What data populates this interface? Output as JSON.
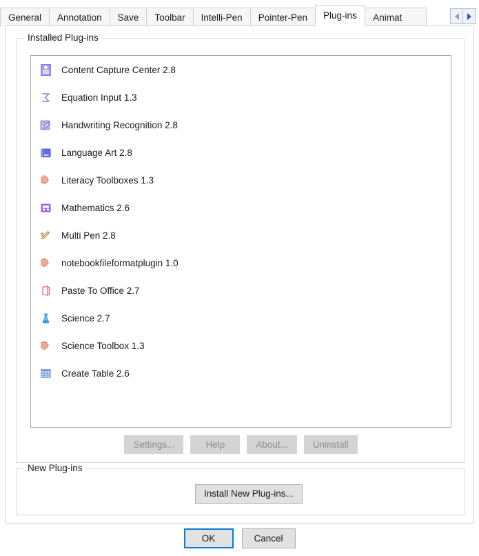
{
  "tabs": [
    {
      "label": "General",
      "active": false
    },
    {
      "label": "Annotation",
      "active": false
    },
    {
      "label": "Save",
      "active": false
    },
    {
      "label": "Toolbar",
      "active": false
    },
    {
      "label": "Intelli-Pen",
      "active": false
    },
    {
      "label": "Pointer-Pen",
      "active": false
    },
    {
      "label": "Plug-ins",
      "active": true
    },
    {
      "label": "Animat",
      "active": false
    }
  ],
  "tab_scroll": {
    "left_icon": "chevron-left-icon",
    "right_icon": "chevron-right-icon",
    "left_color": "#9aa3b4",
    "right_color": "#2a57c4"
  },
  "groups": {
    "installed": {
      "title": "Installed Plug-ins"
    },
    "new": {
      "title": "New Plug-ins"
    }
  },
  "plugins": [
    {
      "name": "Content Capture Center 2.8",
      "icon": "capture-card-icon",
      "color": "#8a7ce0"
    },
    {
      "name": "Equation Input 1.3",
      "icon": "sigma-icon",
      "color": "#9a93d8"
    },
    {
      "name": "Handwriting Recognition 2.8",
      "icon": "handwriting-pen-icon",
      "color": "#7b74d0"
    },
    {
      "name": "Language Art 2.8",
      "icon": "book-icon",
      "color": "#5566dd"
    },
    {
      "name": "Literacy Toolboxes 1.3",
      "icon": "puzzle-piece-icon",
      "color": "#f09a8a"
    },
    {
      "name": "Mathematics 2.6",
      "icon": "calculator-icon",
      "color": "#9b6ee8"
    },
    {
      "name": "Multi Pen 2.8",
      "icon": "pen-icon",
      "color": "#e8a05a"
    },
    {
      "name": "notebookfileformatplugin 1.0",
      "icon": "puzzle-piece-icon",
      "color": "#f09a8a"
    },
    {
      "name": "Paste To Office 2.7",
      "icon": "office-document-icon",
      "color": "#e05a5a"
    },
    {
      "name": "Science 2.7",
      "icon": "flask-icon",
      "color": "#35a8e8"
    },
    {
      "name": "Science Toolbox 1.3",
      "icon": "puzzle-piece-icon",
      "color": "#f09a8a"
    },
    {
      "name": "Create Table 2.6",
      "icon": "table-grid-icon",
      "color": "#7a9ae0"
    }
  ],
  "buttons": {
    "settings": {
      "label": "Settings...",
      "enabled": false
    },
    "help": {
      "label": "Help",
      "enabled": false
    },
    "about": {
      "label": "About...",
      "enabled": false
    },
    "uninstall": {
      "label": "Uninstall",
      "enabled": false
    },
    "install_new": {
      "label": "Install New Plug-ins...",
      "enabled": true
    },
    "ok": {
      "label": "OK",
      "enabled": true,
      "default": true
    },
    "cancel": {
      "label": "Cancel",
      "enabled": true
    }
  },
  "colors": {
    "accent": "#0a7ad4",
    "tab_active_bg": "#ffffff",
    "tab_inactive_bg": "#f6f6f6",
    "button_disabled_bg": "#d4d4d4",
    "button_enabled_bg": "#e1e1e1"
  }
}
